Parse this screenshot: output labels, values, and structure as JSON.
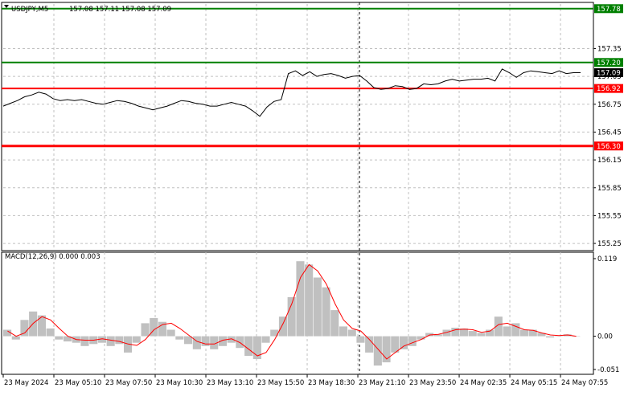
{
  "header": {
    "symbol": "USDJPY,M5",
    "ohlc": "157.08 157.11 157.08 157.09"
  },
  "colors": {
    "price_line": "#000000",
    "grid": "#c0c0c0",
    "green_level": "#008000",
    "red_level": "#ff0000",
    "histogram": "#c0c0c0",
    "signal": "#ff0000",
    "current_price_bg": "#000000",
    "axis_text": "#000000"
  },
  "price_axis": {
    "ticks": [
      "157.35",
      "157.05",
      "156.75",
      "156.45",
      "156.15",
      "155.85",
      "155.55",
      "155.25"
    ]
  },
  "macd_axis": {
    "ticks": [
      "0.119",
      "0.00",
      "-0.051"
    ]
  },
  "time_axis": {
    "labels": [
      "23 May 2024",
      "23 May 05:10",
      "23 May 07:50",
      "23 May 10:30",
      "23 May 13:10",
      "23 May 15:50",
      "23 May 18:30",
      "23 May 21:10",
      "23 May 23:50",
      "24 May 02:35",
      "24 May 05:15",
      "24 May 07:55"
    ]
  },
  "levels": [
    {
      "name": "157.78",
      "price": 157.78,
      "color": "#008000",
      "label": "157.78"
    },
    {
      "name": "157.20",
      "price": 157.2,
      "color": "#008000",
      "label": "157.20"
    },
    {
      "name": "156.92",
      "price": 156.92,
      "color": "#ff0000",
      "label": "156.92"
    },
    {
      "name": "156.30",
      "price": 156.3,
      "color": "#ff0000",
      "label": "156.30"
    }
  ],
  "current_price": {
    "value": 157.09,
    "label": "157.09"
  },
  "macd": {
    "title": "MACD(12,26,9) 0.000 0.003",
    "ylim": [
      -0.051,
      0.119
    ]
  },
  "chart_data": {
    "type": "line",
    "series": [
      {
        "name": "USDJPY,M5",
        "x_label_range": [
          "23 May 2024",
          "24 May 07:55"
        ],
        "values": [
          156.73,
          156.76,
          156.79,
          156.83,
          156.85,
          156.88,
          156.86,
          156.81,
          156.79,
          156.8,
          156.79,
          156.8,
          156.78,
          156.76,
          156.75,
          156.77,
          156.79,
          156.78,
          156.76,
          156.73,
          156.71,
          156.69,
          156.71,
          156.73,
          156.76,
          156.79,
          156.78,
          156.76,
          156.75,
          156.73,
          156.73,
          156.75,
          156.77,
          156.75,
          156.73,
          156.68,
          156.62,
          156.72,
          156.78,
          156.8,
          157.08,
          157.11,
          157.06,
          157.1,
          157.05,
          157.07,
          157.08,
          157.06,
          157.03,
          157.05,
          157.06,
          157.0,
          156.93,
          156.91,
          156.92,
          156.95,
          156.94,
          156.91,
          156.92,
          156.97,
          156.96,
          156.97,
          157.0,
          157.02,
          157.0,
          157.01,
          157.02,
          157.02,
          157.03,
          157.0,
          157.13,
          157.09,
          157.04,
          157.09,
          157.11,
          157.1,
          157.09,
          157.08,
          157.11,
          157.08,
          157.09,
          157.09
        ],
        "ylim": [
          155.19,
          157.83
        ]
      },
      {
        "name": "MACD histogram",
        "values": [
          0.01,
          -0.005,
          0.025,
          0.038,
          0.032,
          0.012,
          -0.005,
          -0.008,
          -0.01,
          -0.015,
          -0.012,
          -0.01,
          -0.015,
          -0.012,
          -0.025,
          -0.01,
          0.02,
          0.028,
          0.022,
          0.01,
          -0.005,
          -0.012,
          -0.02,
          -0.015,
          -0.02,
          -0.015,
          -0.01,
          -0.018,
          -0.03,
          -0.035,
          -0.01,
          0.01,
          0.03,
          0.06,
          0.115,
          0.11,
          0.09,
          0.075,
          0.04,
          0.015,
          0.01,
          -0.01,
          -0.025,
          -0.045,
          -0.04,
          -0.025,
          -0.02,
          -0.015,
          -0.005,
          0.005,
          0.003,
          0.01,
          0.013,
          0.012,
          0.008,
          0.005,
          0.01,
          0.03,
          0.015,
          0.02,
          0.01,
          0.01,
          0.005,
          -0.002,
          0.0,
          0.003,
          0.0
        ]
      },
      {
        "name": "MACD signal",
        "values": [
          0.008,
          0.0,
          0.005,
          0.02,
          0.03,
          0.025,
          0.012,
          0.0,
          -0.005,
          -0.006,
          -0.006,
          -0.004,
          -0.006,
          -0.008,
          -0.012,
          -0.014,
          -0.005,
          0.01,
          0.018,
          0.02,
          0.012,
          0.002,
          -0.008,
          -0.012,
          -0.012,
          -0.006,
          -0.004,
          -0.01,
          -0.02,
          -0.03,
          -0.025,
          -0.005,
          0.02,
          0.05,
          0.09,
          0.11,
          0.1,
          0.08,
          0.05,
          0.025,
          0.012,
          0.008,
          -0.005,
          -0.02,
          -0.035,
          -0.025,
          -0.015,
          -0.01,
          -0.005,
          0.002,
          0.003,
          0.006,
          0.01,
          0.011,
          0.01,
          0.006,
          0.008,
          0.018,
          0.02,
          0.015,
          0.01,
          0.009,
          0.005,
          0.002,
          0.001,
          0.002,
          0.0
        ]
      }
    ]
  }
}
